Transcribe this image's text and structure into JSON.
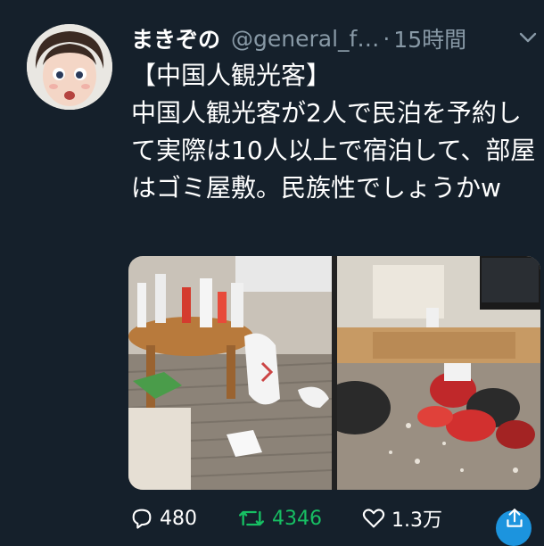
{
  "tweet": {
    "display_name": "まきぞの",
    "handle": "@general_f…",
    "separator": "·",
    "time": "15時間",
    "text": "【中国人観光客】\n中国人観光客が2人で民泊を予約して実際は10人以上で宿泊して、部屋はゴミ屋敷。民族性でしょうかw"
  },
  "stats": {
    "replies": "480",
    "retweets": "4346",
    "likes": "1.3万"
  },
  "colors": {
    "background": "#15202b",
    "muted": "#8899a6",
    "retweet_green": "#17bf63",
    "accent_blue": "#1da1f2"
  }
}
